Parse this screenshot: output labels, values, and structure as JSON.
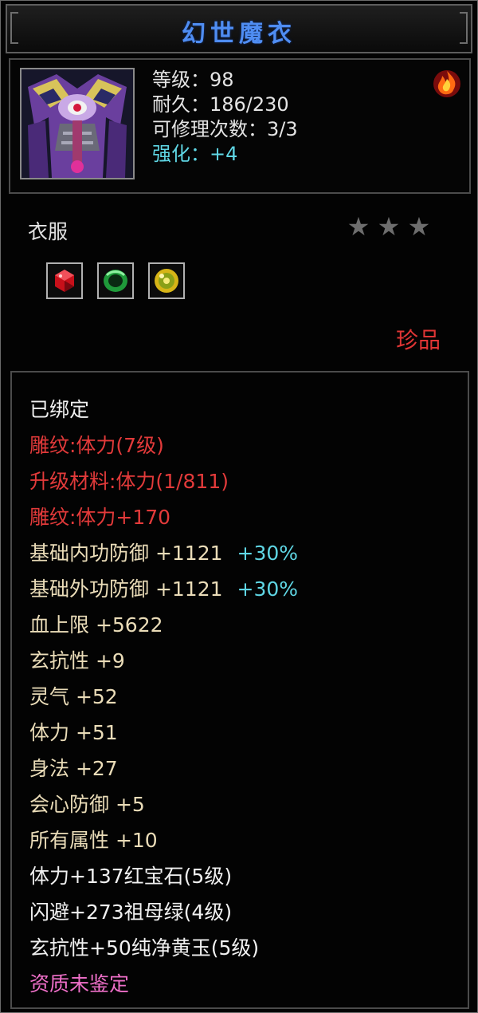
{
  "title": "幻世魔衣",
  "info": {
    "stats": [
      {
        "label": "等级：98",
        "color": "white"
      },
      {
        "label": "耐久：186/230",
        "color": "white"
      },
      {
        "label": "可修理次数：3/3",
        "color": "white"
      },
      {
        "label": "强化：+4",
        "color": "cyan"
      }
    ]
  },
  "item_type": "衣服",
  "star_rating": {
    "filled": 0,
    "total": 3,
    "glyph": "★"
  },
  "gems": [
    {
      "name": "ruby-gem-icon",
      "color": "#c8101a"
    },
    {
      "name": "emerald-gem-icon",
      "color": "#1f9a3a"
    },
    {
      "name": "yellow-jade-gem-icon",
      "color": "#d6b417"
    }
  ],
  "rarity": "珍品",
  "attributes": [
    {
      "text": "已绑定",
      "bonus": "",
      "color": "white"
    },
    {
      "text": "雕纹:体力(7级)",
      "bonus": "",
      "color": "red"
    },
    {
      "text": "升级材料:体力(1/811)",
      "bonus": "",
      "color": "red"
    },
    {
      "text": "雕纹:体力+170",
      "bonus": "",
      "color": "red"
    },
    {
      "text": "基础内功防御  +1121",
      "bonus": "+30%",
      "color": "gold"
    },
    {
      "text": "基础外功防御  +1121",
      "bonus": "+30%",
      "color": "gold"
    },
    {
      "text": "血上限  +5622",
      "bonus": "",
      "color": "gold"
    },
    {
      "text": "玄抗性  +9",
      "bonus": "",
      "color": "gold"
    },
    {
      "text": "灵气  +52",
      "bonus": "",
      "color": "gold"
    },
    {
      "text": "体力  +51",
      "bonus": "",
      "color": "gold"
    },
    {
      "text": "身法  +27",
      "bonus": "",
      "color": "gold"
    },
    {
      "text": "会心防御  +5",
      "bonus": "",
      "color": "gold"
    },
    {
      "text": "所有属性  +10",
      "bonus": "",
      "color": "gold"
    },
    {
      "text": "体力+137红宝石(5级)",
      "bonus": "",
      "color": "white"
    },
    {
      "text": "闪避+273祖母绿(4级)",
      "bonus": "",
      "color": "white"
    },
    {
      "text": "玄抗性+50纯净黄玉(5级)",
      "bonus": "",
      "color": "white"
    },
    {
      "text": "资质未鉴定",
      "bonus": "",
      "color": "pink"
    }
  ]
}
